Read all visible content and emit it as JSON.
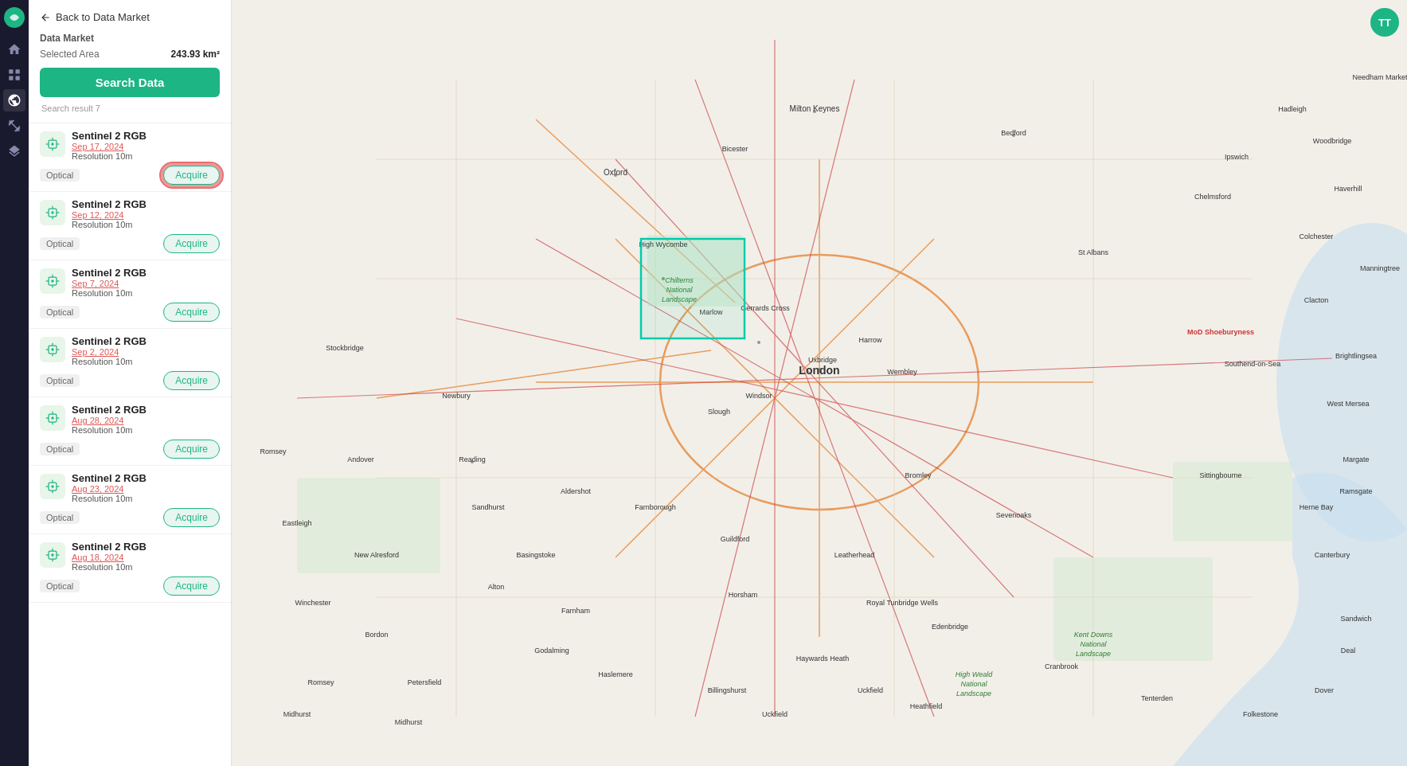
{
  "app": {
    "title": "Data Market",
    "user_initials": "TT"
  },
  "header": {
    "back_label": "Back to Data Market",
    "data_market_label": "Data Market",
    "selected_area_label": "Selected Area",
    "selected_area_value": "243.93 km²",
    "search_btn_label": "Search Data",
    "search_result_label": "Search result 7"
  },
  "results": [
    {
      "name": "Sentinel 2 RGB",
      "date": "Sep 17, 2024",
      "resolution": "Resolution 10m",
      "tag": "Optical",
      "acquire_label": "Acquire",
      "highlighted": true
    },
    {
      "name": "Sentinel 2 RGB",
      "date": "Sep 12, 2024",
      "resolution": "Resolution 10m",
      "tag": "Optical",
      "acquire_label": "Acquire",
      "highlighted": false
    },
    {
      "name": "Sentinel 2 RGB",
      "date": "Sep 7, 2024",
      "resolution": "Resolution 10m",
      "tag": "Optical",
      "acquire_label": "Acquire",
      "highlighted": false
    },
    {
      "name": "Sentinel 2 RGB",
      "date": "Sep 2, 2024",
      "resolution": "Resolution 10m",
      "tag": "Optical",
      "acquire_label": "Acquire",
      "highlighted": false
    },
    {
      "name": "Sentinel 2 RGB",
      "date": "Aug 28, 2024",
      "resolution": "Resolution 10m",
      "tag": "Optical",
      "acquire_label": "Acquire",
      "highlighted": false
    },
    {
      "name": "Sentinel 2 RGB",
      "date": "Aug 23, 2024",
      "resolution": "Resolution 10m",
      "tag": "Optical",
      "acquire_label": "Acquire",
      "highlighted": false
    },
    {
      "name": "Sentinel 2 RGB",
      "date": "Aug 18, 2024",
      "resolution": "Resolution 10m",
      "tag": "Optical",
      "acquire_label": "Acquire",
      "highlighted": false
    }
  ],
  "nav_icons": [
    "home",
    "grid",
    "layers",
    "globe",
    "package",
    "bookmark"
  ],
  "colors": {
    "accent": "#1db584",
    "danger": "#e05555",
    "highlight_ring": "rgba(220,50,50,0.7)"
  }
}
